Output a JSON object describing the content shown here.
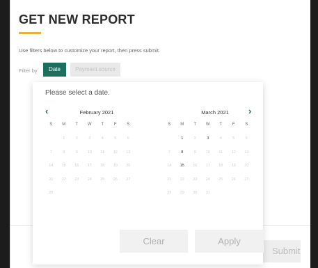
{
  "report": {
    "title": "GET NEW REPORT",
    "instructions": "Use filters below to customize your report, then press submit.",
    "filter_label": "Filter by",
    "filters": [
      {
        "label": "Date",
        "active": true
      },
      {
        "label": "Payment source",
        "active": false
      }
    ],
    "submit_label": "Submit"
  },
  "datepicker": {
    "prompt": "Please select a date.",
    "prev_icon": "chevron-left-icon",
    "next_icon": "chevron-right-icon",
    "weekdays": [
      "S",
      "M",
      "T",
      "W",
      "T",
      "F",
      "S"
    ],
    "months": [
      {
        "name": "February 2021",
        "weeks": [
          [
            {
              "d": ""
            },
            {
              "d": "1"
            },
            {
              "d": "2"
            },
            {
              "d": "3"
            },
            {
              "d": "4"
            },
            {
              "d": "5"
            },
            {
              "d": "6"
            }
          ],
          [
            {
              "d": "7"
            },
            {
              "d": "8"
            },
            {
              "d": "9"
            },
            {
              "d": "10"
            },
            {
              "d": "11"
            },
            {
              "d": "12"
            },
            {
              "d": "13"
            }
          ],
          [
            {
              "d": "14"
            },
            {
              "d": "15"
            },
            {
              "d": "16"
            },
            {
              "d": "17"
            },
            {
              "d": "18"
            },
            {
              "d": "19"
            },
            {
              "d": "20"
            }
          ],
          [
            {
              "d": "21"
            },
            {
              "d": "22"
            },
            {
              "d": "23"
            },
            {
              "d": "24"
            },
            {
              "d": "25"
            },
            {
              "d": "26"
            },
            {
              "d": "27"
            }
          ],
          [
            {
              "d": "28"
            },
            {
              "d": ""
            },
            {
              "d": ""
            },
            {
              "d": ""
            },
            {
              "d": ""
            },
            {
              "d": ""
            },
            {
              "d": ""
            }
          ]
        ]
      },
      {
        "name": "March 2021",
        "weeks": [
          [
            {
              "d": ""
            },
            {
              "d": "1",
              "a": true
            },
            {
              "d": "2"
            },
            {
              "d": "3",
              "a": true
            },
            {
              "d": "4"
            },
            {
              "d": "5"
            },
            {
              "d": "6"
            }
          ],
          [
            {
              "d": "7"
            },
            {
              "d": "8",
              "a": true
            },
            {
              "d": "9"
            },
            {
              "d": "10"
            },
            {
              "d": "11"
            },
            {
              "d": "12"
            },
            {
              "d": "13"
            }
          ],
          [
            {
              "d": "14"
            },
            {
              "d": "15",
              "a": true
            },
            {
              "d": "16"
            },
            {
              "d": "17"
            },
            {
              "d": "18"
            },
            {
              "d": "19"
            },
            {
              "d": "20"
            }
          ],
          [
            {
              "d": "21"
            },
            {
              "d": "22"
            },
            {
              "d": "23"
            },
            {
              "d": "24"
            },
            {
              "d": "25"
            },
            {
              "d": "26"
            },
            {
              "d": "27"
            }
          ],
          [
            {
              "d": "28"
            },
            {
              "d": "29"
            },
            {
              "d": "30"
            },
            {
              "d": "31"
            },
            {
              "d": ""
            },
            {
              "d": ""
            },
            {
              "d": ""
            }
          ]
        ]
      }
    ],
    "clear_label": "Clear",
    "apply_label": "Apply"
  },
  "colors": {
    "accent": "#1c6e5e",
    "underline": "#e8b23a",
    "backdrop": "#1c1c1c"
  }
}
